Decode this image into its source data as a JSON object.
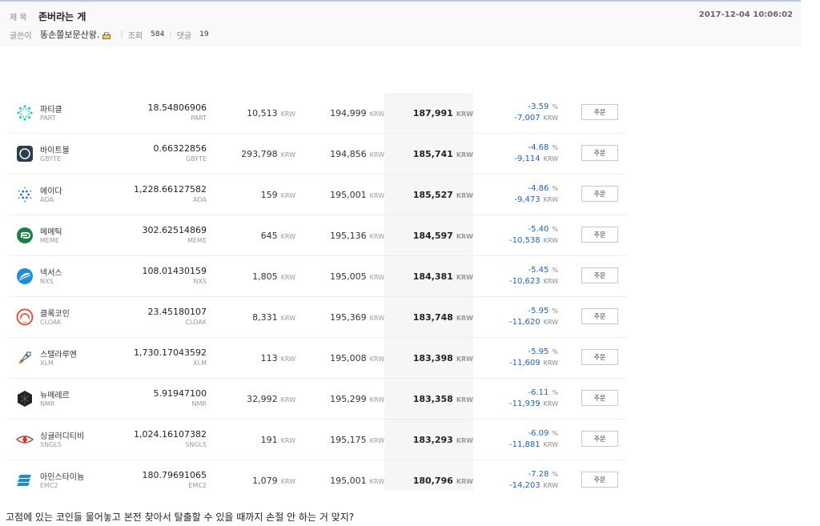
{
  "header": {
    "title_label": "제 목",
    "title": "존버라는 게",
    "date": "2017-12-04 10:06:02",
    "author_label": "글쓴이",
    "author": "똥손쫄보문산왕.",
    "views_label": "조회",
    "views": "584",
    "comments_label": "댓글",
    "comments": "19"
  },
  "rows": [
    {
      "name": "파티클",
      "symbol": "PART",
      "amount": "18.54806906",
      "amount_unit": "PART",
      "c1": "10,513",
      "c2": "194,999",
      "c3": "187,991",
      "pct": "-3.59",
      "diff": "-7,007",
      "icon": "part-icon",
      "color": "#2fc9b4"
    },
    {
      "name": "바이트볼",
      "symbol": "GBYTE",
      "amount": "0.66322856",
      "amount_unit": "GBYTE",
      "c1": "293,798",
      "c2": "194,856",
      "c3": "185,741",
      "pct": "-4.68",
      "diff": "-9,114",
      "icon": "gbyte-icon",
      "color": "#2c3e50"
    },
    {
      "name": "에이다",
      "symbol": "ADA",
      "amount": "1,228.66127582",
      "amount_unit": "ADA",
      "c1": "159",
      "c2": "195,001",
      "c3": "185,527",
      "pct": "-4.86",
      "diff": "-9,473",
      "icon": "ada-icon",
      "color": "#2a71d0"
    },
    {
      "name": "메메틱",
      "symbol": "MEME",
      "amount": "302.62514869",
      "amount_unit": "MEME",
      "c1": "645",
      "c2": "195,136",
      "c3": "184,597",
      "pct": "-5.40",
      "diff": "-10,538",
      "icon": "meme-icon",
      "color": "#1e7d4a"
    },
    {
      "name": "넥서스",
      "symbol": "NXS",
      "amount": "108.01430159",
      "amount_unit": "NXS",
      "c1": "1,805",
      "c2": "195,005",
      "c3": "184,381",
      "pct": "-5.45",
      "diff": "-10,623",
      "icon": "nxs-icon",
      "color": "#1f8fd8"
    },
    {
      "name": "클록코인",
      "symbol": "CLOAK",
      "amount": "23.45180107",
      "amount_unit": "CLOAK",
      "c1": "8,331",
      "c2": "195,369",
      "c3": "183,748",
      "pct": "-5.95",
      "diff": "-11,620",
      "icon": "cloak-icon",
      "color": "#e2533a"
    },
    {
      "name": "스텔라루멘",
      "symbol": "XLM",
      "amount": "1,730.17043592",
      "amount_unit": "XLM",
      "c1": "113",
      "c2": "195,008",
      "c3": "183,398",
      "pct": "-5.95",
      "diff": "-11,609",
      "icon": "xlm-icon",
      "color": "#5b6c7d"
    },
    {
      "name": "뉴메레르",
      "symbol": "NMR",
      "amount": "5.91947100",
      "amount_unit": "NMR",
      "c1": "32,992",
      "c2": "195,299",
      "c3": "183,358",
      "pct": "-6.11",
      "diff": "-11,939",
      "icon": "nmr-icon",
      "color": "#222222"
    },
    {
      "name": "싱귤러디티비",
      "symbol": "SNGLS",
      "amount": "1,024.16107382",
      "amount_unit": "SNGLS",
      "c1": "191",
      "c2": "195,175",
      "c3": "183,293",
      "pct": "-6.09",
      "diff": "-11,881",
      "icon": "sngls-icon",
      "color": "#c0392b"
    },
    {
      "name": "아인스타이늄",
      "symbol": "EMC2",
      "amount": "180.79691065",
      "amount_unit": "EMC2",
      "c1": "1,079",
      "c2": "195,001",
      "c3": "180,796",
      "pct": "-7.28",
      "diff": "-14,203",
      "icon": "emc2-icon",
      "color": "#1c8ad6"
    }
  ],
  "units": {
    "krw": "KRW",
    "pct": "%"
  },
  "order_label": "주문",
  "footer_text": "고점에 있는 코인들 물어놓고 본전 찾아서 탈출할 수 있을 때까지 손절 안 하는 거 맞지?"
}
